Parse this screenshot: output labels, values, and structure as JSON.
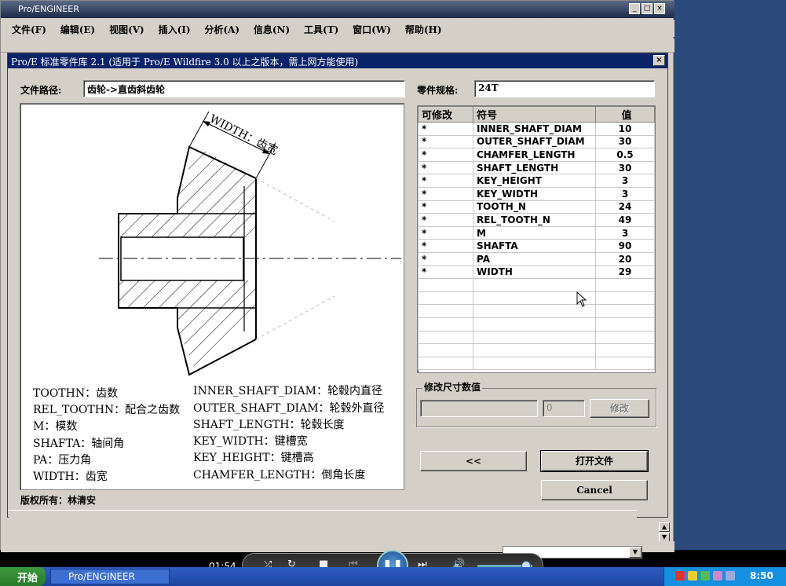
{
  "app": {
    "window_title": "Pro/ENGINEER",
    "menu": [
      "文件(F)",
      "编辑(E)",
      "视图(V)",
      "插入(I)",
      "分析(A)",
      "信息(N)",
      "工具(T)",
      "窗口(W)",
      "帮助(H)"
    ]
  },
  "dialog": {
    "title": "Pro/E 标准零件库 2.1 (适用于 Pro/E Wildfire 3.0 以上之版本，需上网方能使用)",
    "close": "×",
    "path_label": "文件路径:",
    "path_value": "齿轮->直齿斜齿轮",
    "spec_label": "零件规格:",
    "spec_value": "24T",
    "drawing": {
      "width_annotation": "WIDTH：齿宽",
      "legend_left": [
        "TOOTHN：齿数",
        "REL_TOOTHN：配合之齿数",
        "M：模数",
        "SHAFTA：轴间角",
        "PA：压力角",
        "WIDTH：齿宽"
      ],
      "legend_right": [
        "INNER_SHAFT_DIAM：轮毂内直径",
        "OUTER_SHAFT_DIAM：轮毂外直径",
        "SHAFT_LENGTH：轮毂长度",
        "KEY_WIDTH：键槽宽",
        "KEY_HEIGHT：键槽高",
        "CHAMFER_LENGTH：倒角长度"
      ]
    },
    "table": {
      "headers": [
        "可修改",
        "符号",
        "值"
      ],
      "rows": [
        {
          "mod": "*",
          "sym": "INNER_SHAFT_DIAM",
          "val": "10"
        },
        {
          "mod": "*",
          "sym": "OUTER_SHAFT_DIAM",
          "val": "30"
        },
        {
          "mod": "*",
          "sym": "CHAMFER_LENGTH",
          "val": "0.5"
        },
        {
          "mod": "*",
          "sym": "SHAFT_LENGTH",
          "val": "30"
        },
        {
          "mod": "*",
          "sym": "KEY_HEIGHT",
          "val": "3"
        },
        {
          "mod": "*",
          "sym": "KEY_WIDTH",
          "val": "3"
        },
        {
          "mod": "*",
          "sym": "TOOTH_N",
          "val": "24"
        },
        {
          "mod": "*",
          "sym": "REL_TOOTH_N",
          "val": "49"
        },
        {
          "mod": "*",
          "sym": "M",
          "val": "3"
        },
        {
          "mod": "*",
          "sym": "SHAFTA",
          "val": "90"
        },
        {
          "mod": "*",
          "sym": "PA",
          "val": "20"
        },
        {
          "mod": "*",
          "sym": "WIDTH",
          "val": "29"
        }
      ]
    },
    "modify_group_label": "修改尺寸数值",
    "modify_value": "0",
    "modify_button": "修改",
    "back_button": "<<",
    "open_button": "打开文件",
    "cancel_button": "Cancel",
    "copyright": "版权所有：林清安"
  },
  "player": {
    "time": "01:54"
  },
  "taskbar": {
    "start": "开始",
    "task_item": "Pro/ENGINEER",
    "clock": "8:50"
  }
}
